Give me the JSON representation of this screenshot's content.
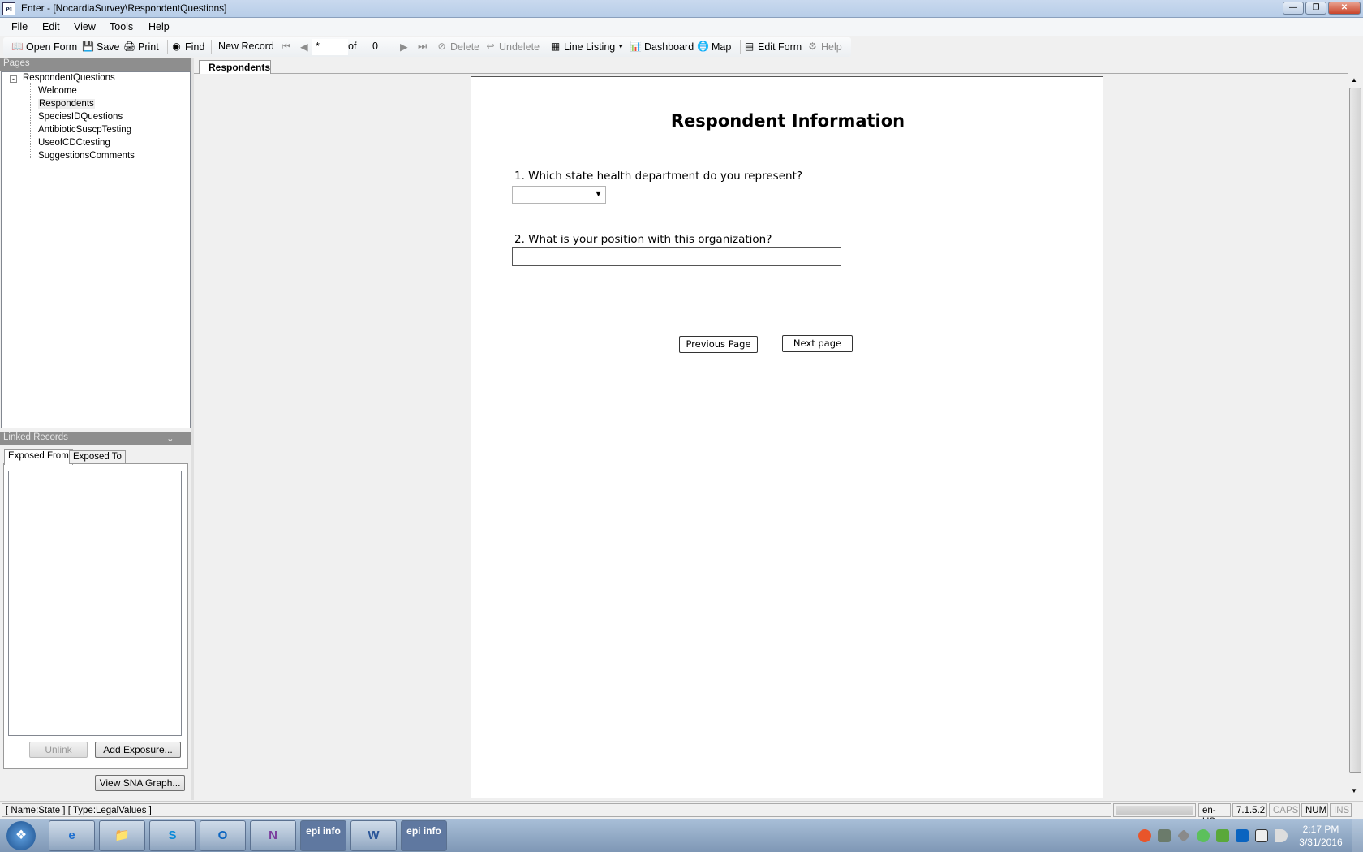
{
  "window": {
    "title": "Enter - [NocardiaSurvey\\RespondentQuestions]"
  },
  "menu": [
    "File",
    "Edit",
    "View",
    "Tools",
    "Help"
  ],
  "toolbar": {
    "open_form": "Open Form",
    "save": "Save",
    "print": "Print",
    "find": "Find",
    "new_record": "New Record",
    "record_value": "*",
    "of": "of",
    "record_count": "0",
    "delete": "Delete",
    "undelete": "Undelete",
    "line_listing": "Line Listing",
    "dashboard": "Dashboard",
    "map": "Map",
    "edit_form": "Edit Form",
    "help": "Help"
  },
  "pages": {
    "header": "Pages",
    "root": "RespondentQuestions",
    "items": [
      "Welcome",
      "Respondents",
      "SpeciesIDQuestions",
      "AntibioticSuscpTesting",
      "UseofCDCtesting",
      "SuggestionsComments"
    ],
    "selected": "Respondents"
  },
  "linked": {
    "header": "Linked Records",
    "tabs": [
      "Exposed From",
      "Exposed To"
    ],
    "unlink": "Unlink",
    "add_exposure": "Add Exposure...",
    "view_sna": "View SNA Graph..."
  },
  "main": {
    "tab": "Respondents",
    "title": "Respondent Information",
    "q1": "1. Which state health department do you represent?",
    "q1_value": "",
    "q2": "2. What is your position with this organization?",
    "q2_value": "",
    "prev": "Previous Page",
    "next": "Next page"
  },
  "status": {
    "field": "[ Name:State ] [ Type:LegalValues ]",
    "locale": "en-US",
    "version": "7.1.5.2",
    "caps": "CAPS",
    "num": "NUM",
    "ins": "INS"
  },
  "taskbar": {
    "time": "2:17 PM",
    "date": "3/31/2016",
    "apps": [
      "Internet Explorer",
      "File Explorer",
      "Skype",
      "Outlook",
      "OneNote",
      "Epi Info",
      "Word",
      "Epi Info"
    ],
    "epi_label": "epi info"
  }
}
